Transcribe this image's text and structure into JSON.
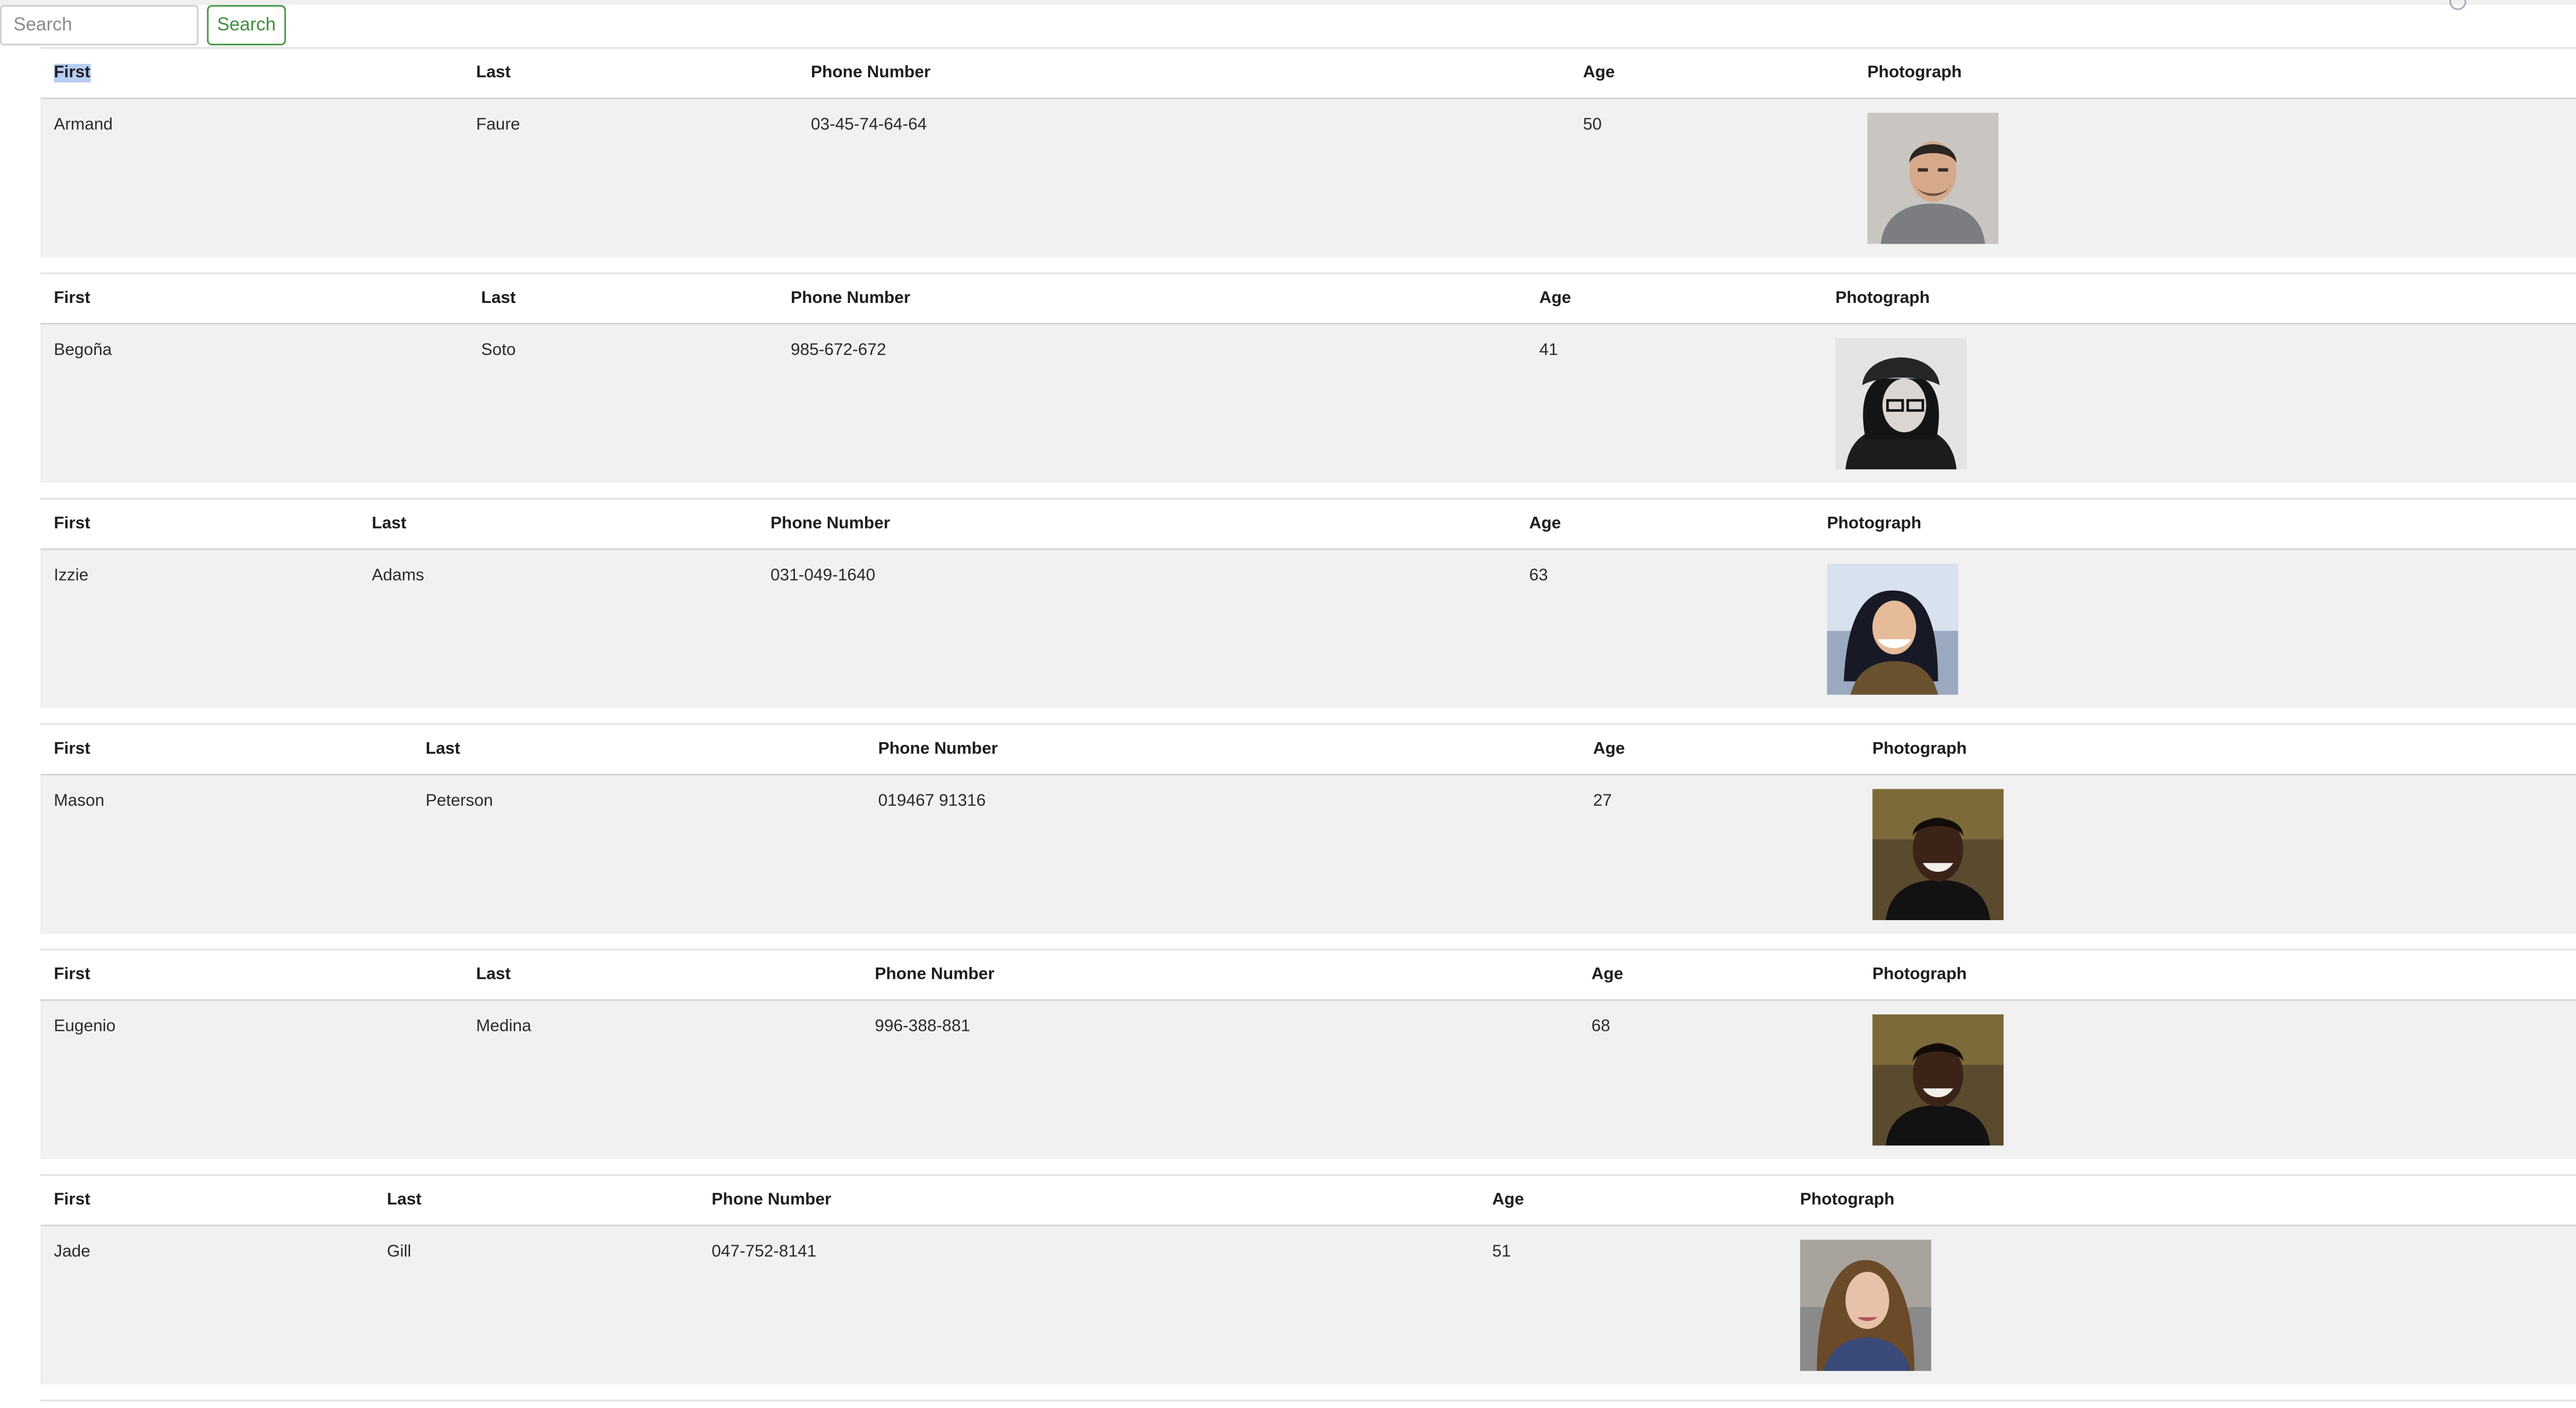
{
  "search": {
    "placeholder": "Search",
    "value": "",
    "button_label": "Search",
    "button_color": "#3f8f3f"
  },
  "columns": {
    "first": "First",
    "last": "Last",
    "phone": "Phone Number",
    "age": "Age",
    "photo": "Photograph"
  },
  "people": [
    {
      "first": "Armand",
      "last": "Faure",
      "phone": "03-45-74-64-64",
      "age": "50",
      "photo_icon": "man-portrait"
    },
    {
      "first": "Begoña",
      "last": "Soto",
      "phone": "985-672-672",
      "age": "41",
      "photo_icon": "woman-beanie-glasses-portrait"
    },
    {
      "first": "Izzie",
      "last": "Adams",
      "phone": "031-049-1640",
      "age": "63",
      "photo_icon": "woman-smiling-portrait"
    },
    {
      "first": "Mason",
      "last": "Peterson",
      "phone": "019467 91316",
      "age": "27",
      "photo_icon": "man-smiling-portrait"
    },
    {
      "first": "Eugenio",
      "last": "Medina",
      "phone": "996-388-881",
      "age": "68",
      "photo_icon": "man-smiling-portrait"
    },
    {
      "first": "Jade",
      "last": "Gill",
      "phone": "047-752-8141",
      "age": "51",
      "photo_icon": "woman-curly-hair-portrait"
    }
  ]
}
